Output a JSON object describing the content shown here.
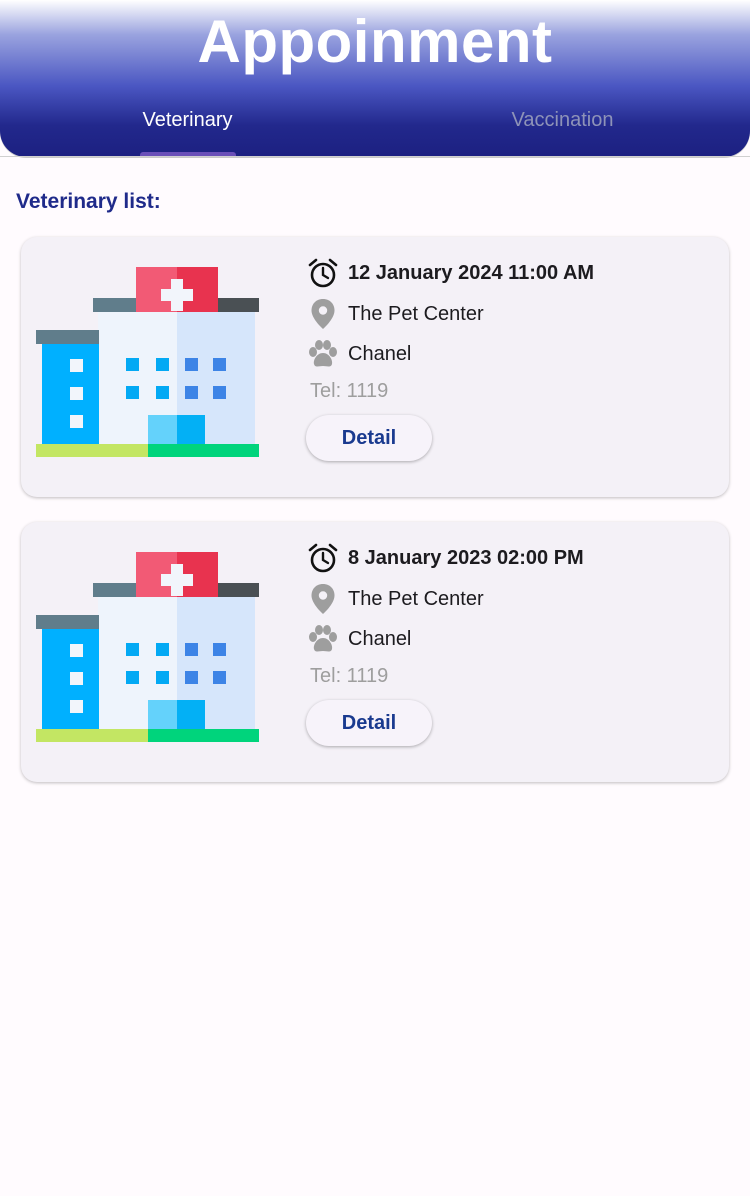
{
  "header": {
    "title": "Appoinment",
    "tabs": [
      {
        "label": "Veterinary",
        "active": true
      },
      {
        "label": "Vaccination",
        "active": false
      }
    ]
  },
  "list": {
    "label": "Veterinary list:",
    "cards": [
      {
        "datetime": "12 January 2024 11:00 AM",
        "place": "The Pet Center",
        "pet": "Chanel",
        "tel": "Tel: 1119",
        "button": "Detail",
        "image": "hospital-illustration"
      },
      {
        "datetime": "8 January 2023 02:00 PM",
        "place": "The Pet Center",
        "pet": "Chanel",
        "tel": "Tel: 1119",
        "button": "Detail",
        "image": "hospital-illustration"
      }
    ]
  },
  "icons": {
    "date": "alarm-clock-icon",
    "place": "location-pin-icon",
    "pet": "paw-icon"
  },
  "colors": {
    "header_top": "#ffffff",
    "header_bottom": "#1c2081",
    "accent": "#1f2a8a",
    "button_text": "#1a3a8f",
    "card_bg": "#f4f1f7"
  }
}
